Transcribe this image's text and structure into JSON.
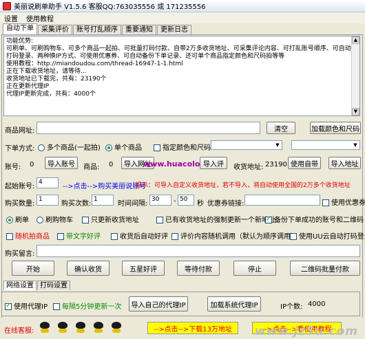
{
  "window": {
    "title": "美丽说刷单助手 V1.5.6 客服QQ:763035556 或 171235556"
  },
  "menu": [
    "设置",
    "使用教程"
  ],
  "tabs": [
    "自动下单",
    "采集评价",
    "账号打乱顺序",
    "重要通知",
    "更新日志"
  ],
  "log": {
    "lines": [
      "功能优势:",
      "",
      "可刷单、可刷购物车、可多个商品一起拍、可批量打码付款、自带2万多收货地址、可采集评论内容、可打乱账号顺序、可自动",
      "打码登录、两种换IP方式、可使用优惠券、可自动备份下单记录、还可单个商品指定颜色和尺码拍等等",
      "",
      "使用教程：http://miandoudou.com/thread-16947-1-1.html",
      "",
      "",
      "正在下载收货地址，请等待...",
      "收货地址已下载完，共有：23190个",
      "正在更新代理IP",
      "代理IP更新完成，共有：4000个"
    ]
  },
  "product": {
    "url_label": "商品网址:",
    "url_value": "",
    "clear_button": "清空",
    "add_color_size_button": "加载颜色和尺码"
  },
  "order_mode": {
    "label": "下单方式:",
    "options": [
      "多个商品(一起拍)",
      "单个商品"
    ],
    "selected": "单个商品",
    "color_size_label": "指定颜色和尺码:"
  },
  "counts": {
    "accounts_label": "账号:",
    "accounts_value": "0",
    "import_accounts": "导入账号",
    "products_label": "商品:",
    "products_value": "0",
    "import_url_prefix": "导入网址",
    "watermark": "www.huacolor.com",
    "import_reviews": "导入评",
    "address_label": "收货地址:",
    "address_value": "23190",
    "use_own": "使用自带",
    "import_address": "导入地址"
  },
  "start_account": {
    "label": "起始账号:",
    "value": "4",
    "hint_link": "-->点击-->购买美丽说账号",
    "tip": "提示：可导入自定义收货地址，若不导入，将自动使用全国的2万多个收货地址"
  },
  "purchase": {
    "qty_label": "购买数量:",
    "qty_value": "1",
    "times_label": "购买次数:",
    "times_value": "1",
    "interval_label": "时间间隔:",
    "interval_from": "30",
    "interval_to": "50",
    "seconds": "秒",
    "coupon_label": "优惠券链接:",
    "coupon_value": "",
    "use_coupon": "使用优惠券"
  },
  "options_row1": {
    "radios": [
      "刷单",
      "刷购物车"
    ],
    "selected": "刷单",
    "checks": [
      {
        "label": "只更新收货地址",
        "checked": false
      },
      {
        "label": "已有收货地址的强制更新一个新地址",
        "checked": false
      },
      {
        "label": "备份下单成功的账号和二维码",
        "checked": true
      }
    ]
  },
  "options_row2": [
    {
      "label": "随机拍商品",
      "checked": false,
      "color": "red"
    },
    {
      "label": "带文字好评",
      "checked": false,
      "color": "green"
    },
    {
      "label": "收货后自动好评",
      "checked": false,
      "color": "black"
    },
    {
      "label": "评价内容随机调用（默认为顺序调用）",
      "checked": false,
      "color": "black"
    },
    {
      "label": "使用UU云自动打码登录",
      "checked": false,
      "color": "black"
    }
  ],
  "message": {
    "label": "购买留言:",
    "value": ""
  },
  "actions": [
    "开始",
    "确认收货",
    "五星好评",
    "等待付款",
    "停止",
    "二维码批量付款"
  ],
  "bottom_tabs": [
    "网络设置",
    "打码设置"
  ],
  "network": {
    "use_proxy": "使用代理IP",
    "refresh": "每隔5分钟更新一次",
    "import_own_proxy": "导入自己的代理IP",
    "load_system_proxy": "加载系统代理IP",
    "ip_count_label": "IP个数:",
    "ip_count_value": "4000"
  },
  "status": {
    "online_label": "在线客服:",
    "download_link": "-->点击-->下载13万地址",
    "tutorial_link": "-->点击-->看使用教程",
    "site_watermark": "www.jz5u.com"
  }
}
